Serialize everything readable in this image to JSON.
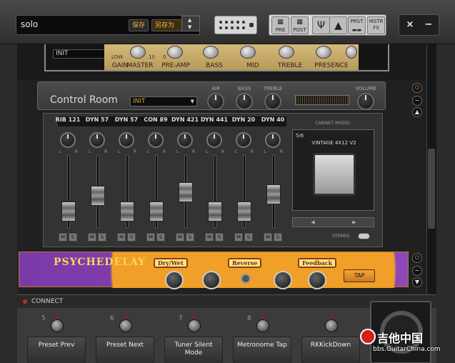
{
  "topbar": {
    "preset_name": "solo",
    "save_label": "保存",
    "saveas_label": "另存为",
    "tools": [
      {
        "label": "PRE"
      },
      {
        "label": "POST"
      },
      {
        "label": ""
      },
      {
        "label": ""
      },
      {
        "label": "PRST"
      },
      {
        "label": "MSTR FX"
      }
    ]
  },
  "amp": {
    "preset": "INIT",
    "knobs": [
      "GAIN",
      "MASTER",
      "PRE-AMP",
      "BASS",
      "MID",
      "TREBLE",
      "PRESENCE"
    ],
    "scale_low": "LOW",
    "scale_10": "10",
    "scale_0": "0"
  },
  "control_room": {
    "title": "Control Room",
    "preset": "INIT",
    "knobs": [
      "AIR",
      "BASS",
      "TREBLE",
      "VOLUME"
    ]
  },
  "mixer": {
    "channels": [
      {
        "name": "RIB 121",
        "fader": 0.12
      },
      {
        "name": "DYN 57",
        "fader": 0.42
      },
      {
        "name": "DYN 57",
        "fader": 0.12
      },
      {
        "name": "CON 89",
        "fader": 0.12
      },
      {
        "name": "DYN 421",
        "fader": 0.48
      },
      {
        "name": "DYN 441",
        "fader": 0.12
      },
      {
        "name": "DYN 20",
        "fader": 0.12
      },
      {
        "name": "DYN 40",
        "fader": 0.44
      }
    ],
    "l_label": "L",
    "r_label": "R",
    "m_label": "M",
    "s_label": "S",
    "cabinet": {
      "title": "CABINET MODEL",
      "count": "5/6",
      "name": "VINTAGE 4X12 V2",
      "stereo_label": "STEREO"
    }
  },
  "psychedelay": {
    "title": "PSYCHEDELAY",
    "labels": [
      "Dry/Wet",
      "Reverse",
      "Feedback"
    ],
    "tap_label": "TAP"
  },
  "connect": {
    "label": "CONNECT",
    "footswitches": [
      {
        "num": "5",
        "label": "Preset Prev"
      },
      {
        "num": "6",
        "label": "Preset Next"
      },
      {
        "num": "7",
        "label": "Tuner Silent Mode"
      },
      {
        "num": "8",
        "label": "Metronome Tap"
      },
      {
        "num": "",
        "label": "RKKickDown"
      }
    ]
  },
  "watermark": {
    "text": "吉他中国",
    "sub": "bbs.GuitarChina.com"
  }
}
